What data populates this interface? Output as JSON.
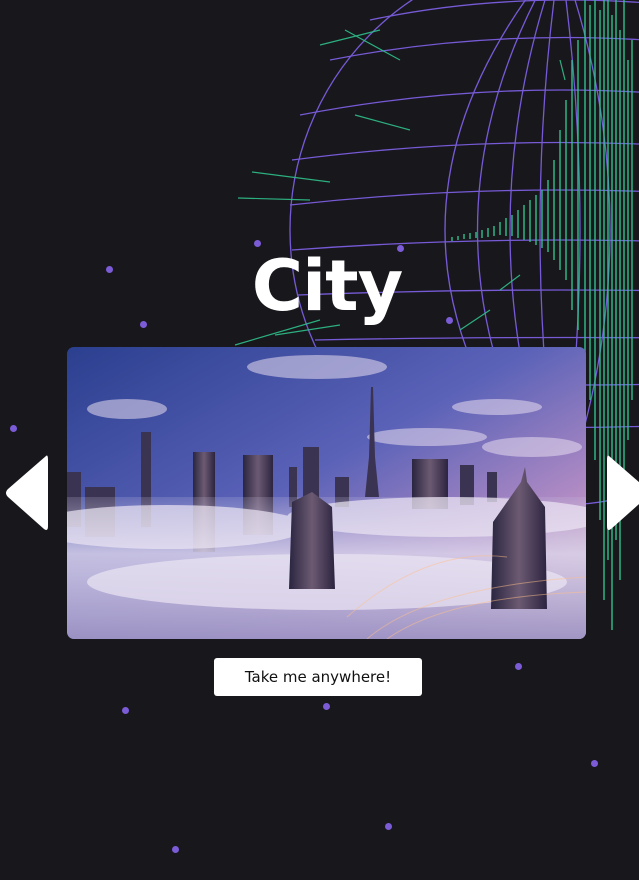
{
  "carousel": {
    "title": "City",
    "photo_subject": "skyline-above-clouds",
    "prev_icon": "triangle-left-icon",
    "next_icon": "triangle-right-icon"
  },
  "cta": {
    "label": "Take me anywhere!"
  },
  "colors": {
    "background": "#18171c",
    "wireframe": "#7c5ee0",
    "bars": "#2fc08a",
    "dots": "#7b5cd6",
    "button": "#ffffff"
  }
}
